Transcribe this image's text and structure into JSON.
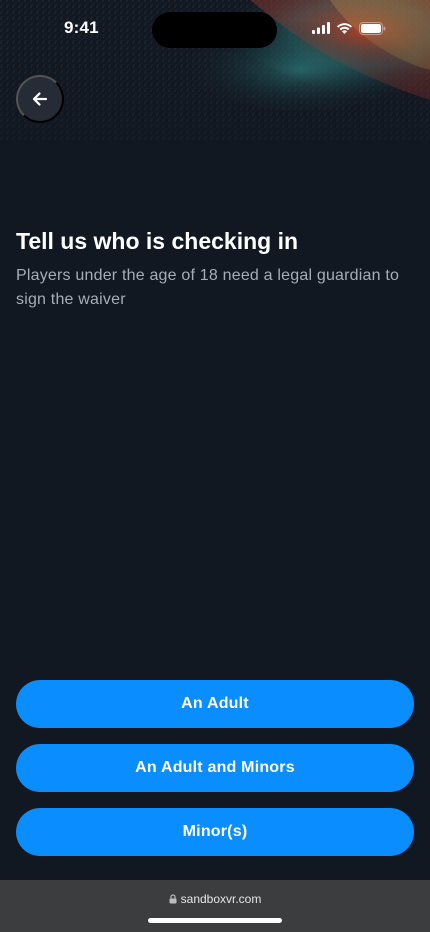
{
  "status_bar": {
    "time": "9:41",
    "icons": [
      "cellular-signal-icon",
      "wifi-icon",
      "battery-icon"
    ]
  },
  "header": {
    "back_icon": "arrow-left-icon"
  },
  "content": {
    "title": "Tell us who is checking in",
    "subtitle": "Players under the age of 18 need a legal guardian to sign the waiver"
  },
  "options": [
    {
      "label": "An Adult"
    },
    {
      "label": "An Adult and Minors"
    },
    {
      "label": "Minor(s)"
    }
  ],
  "browser": {
    "url": "sandboxvr.com",
    "lock_icon": "lock-icon"
  },
  "colors": {
    "background": "#121822",
    "button": "#0a8dff",
    "subtitle": "#a7adb6",
    "url_bar": "#3c3d3f"
  }
}
